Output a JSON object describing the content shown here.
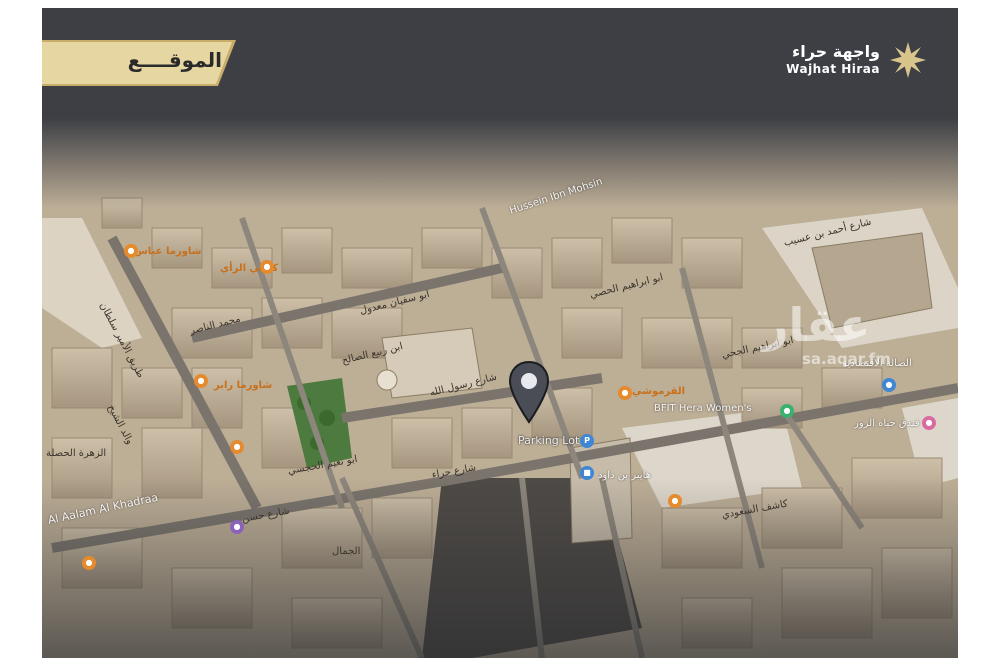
{
  "title": "الموقــــع",
  "brand": {
    "name_ar": "واجهة حراء",
    "name_en": "Wajhat Hiraa",
    "logo": "star-burst-logo"
  },
  "watermark": {
    "text_ar": "عقار",
    "url": "sa.aqar.fm"
  },
  "marker": {
    "icon": "location-pin-icon",
    "label": "Parking Lot"
  },
  "labels": {
    "hussein": "Hussein Ibn Mohsin",
    "street_ahmad": "شارع أحمد بن عسيب",
    "salah_eq": "الصالة الاقتصادية",
    "bfit": "BFIT Hera Women's",
    "hayat": "فندق حياة الزور",
    "qarmoushi": "القرموشي",
    "hera_st": "شارع حراء",
    "shawarma": "شاورما رابر",
    "abbas": "شاورما عباس",
    "coffee": "كوفي الرأي",
    "alaalam": "Al Aalam Al Khadraa",
    "maher": "هايبر بن داود",
    "ibrahim": "ابو ابراهيم الجحي",
    "abusufyan": "ابو سفيان معدول",
    "nasir": "محمد الناصر",
    "rasoul": "شارع رسول الله",
    "zahra": "الزهرة الحصلة",
    "aljamal": "الجمال",
    "sultan": "طريق الأمير سلطان",
    "hassan": "شارع حسن",
    "kashaf": "كاشف السعودي",
    "ibrahim2": "ابو ابراهيم الحصي",
    "waleed": "والد الشيخ",
    "naim": "ابو نعيم الحجسي",
    "bin_saleh": "ابن ربيع الصالح"
  },
  "colors": {
    "header_bg": "#3d3f45",
    "gold": "#d8c48a",
    "map_base": "#c8b8a0",
    "road": "#8a8278"
  }
}
